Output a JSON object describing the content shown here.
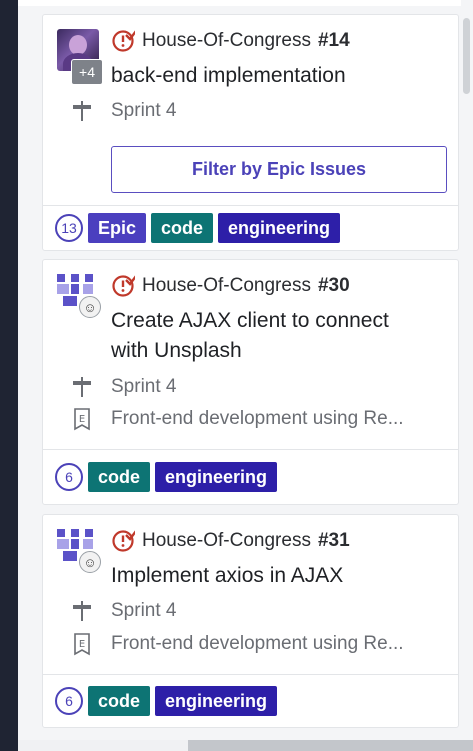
{
  "colors": {
    "accent": "#4b42b8",
    "repo_icon": "#c0392b",
    "label_epic": "#4b3fbf",
    "label_code": "#0d7474",
    "label_engineering": "#2d1fa8"
  },
  "cards": [
    {
      "avatar_extra": "+4",
      "repo": "House-Of-Congress",
      "number": "#14",
      "title": "back-end implementation",
      "sprint_icon": "milestone-icon",
      "sprint": "Sprint 4",
      "filter_button": "Filter by Epic Issues",
      "count": "13",
      "labels": [
        "Epic",
        "code",
        "engineering"
      ]
    },
    {
      "repo": "House-Of-Congress",
      "number": "#30",
      "title_line1": "Create AJAX client to connect",
      "title_line2": "with Unsplash",
      "sprint": "Sprint 4",
      "epic_icon": "epic-icon",
      "epic": "Front-end development using Re...",
      "count": "6",
      "labels": [
        "code",
        "engineering"
      ]
    },
    {
      "repo": "House-Of-Congress",
      "number": "#31",
      "title": "Implement axios in AJAX",
      "sprint": "Sprint 4",
      "epic": "Front-end development using Re...",
      "count": "6",
      "labels": [
        "code",
        "engineering"
      ]
    }
  ]
}
